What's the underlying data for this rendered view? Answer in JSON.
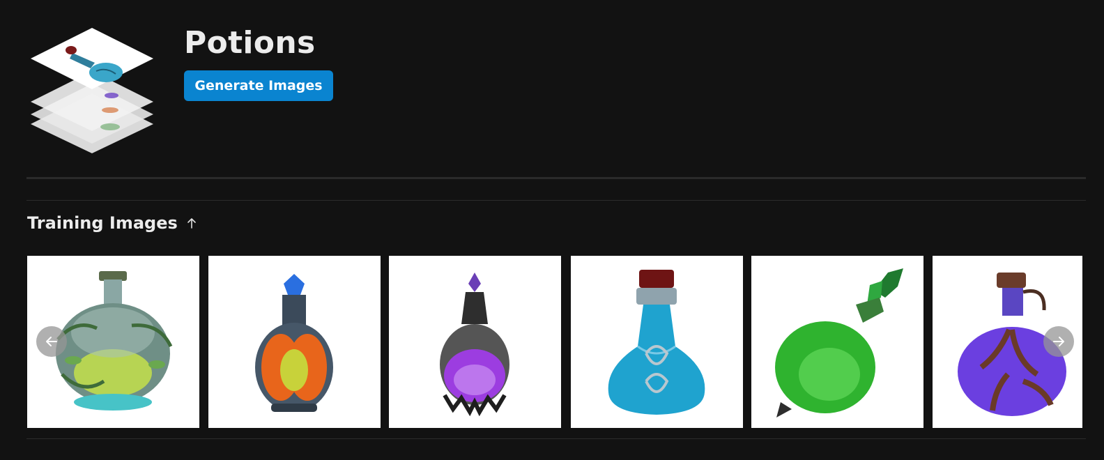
{
  "page": {
    "title": "Potions"
  },
  "actions": {
    "generate_label": "Generate Images"
  },
  "training": {
    "title": "Training Images",
    "sort_icon": "arrow-up-icon"
  },
  "carousel": {
    "prev_icon": "arrow-left-icon",
    "next_icon": "arrow-right-icon",
    "images": [
      {
        "name": "green-vine-potion",
        "color": "#c4e04a"
      },
      {
        "name": "orange-crystal-potion",
        "color": "#e8651b"
      },
      {
        "name": "purple-gothic-potion",
        "color": "#9c3de0"
      },
      {
        "name": "blue-celtic-potion",
        "color": "#1fa3cf"
      },
      {
        "name": "green-leaf-potion",
        "color": "#2fb32f"
      },
      {
        "name": "purple-branch-potion",
        "color": "#6b3fe0"
      }
    ]
  },
  "colors": {
    "background": "#121212",
    "accent": "#0a84d0"
  }
}
